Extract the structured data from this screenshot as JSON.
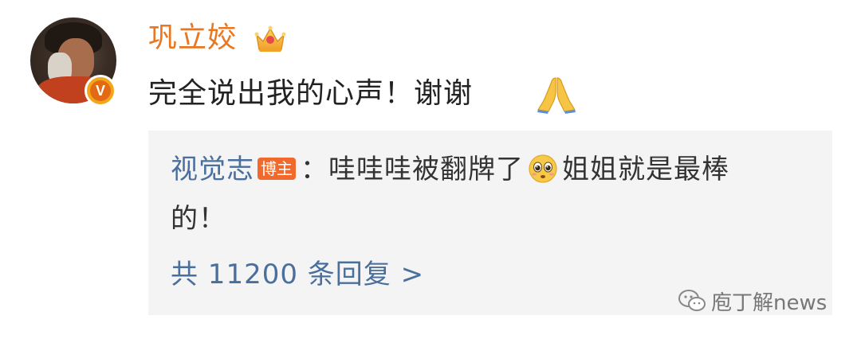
{
  "post": {
    "username": "巩立姣",
    "comment": "完全说出我的心声！谢谢",
    "icons": {
      "crown": "crown-badge-icon",
      "verified": "verified-v-icon",
      "pray": "pray-emoji-icon"
    },
    "verified_glyph": "V"
  },
  "reply": {
    "author": "视觉志",
    "author_badge": "博主",
    "separator": "：",
    "text_line1": "哇哇哇被翻牌了",
    "text_line1_b": "姐姐就是最棒",
    "text_line2": "的！",
    "more_replies": "共 11200 条回复 >",
    "icons": {
      "emoji": "scared-face-emoji-icon"
    }
  },
  "watermark": {
    "text": "庖丁解news",
    "icon": "wechat-logo-icon"
  },
  "colors": {
    "username": "#e87722",
    "link": "#4a6f9c",
    "badge_bg": "#f26a2b",
    "reply_bg": "#f4f4f5",
    "text": "#222222"
  }
}
